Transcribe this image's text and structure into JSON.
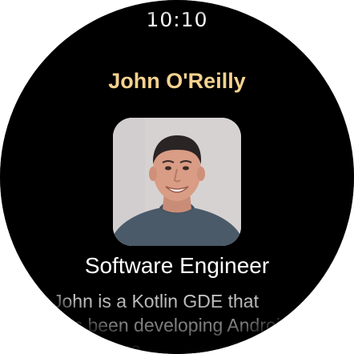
{
  "status": {
    "time": "10:10"
  },
  "profile": {
    "name": "John O'Reilly",
    "title": "Software Engineer",
    "bio": "John is a Kotlin GDE that has been developing Android apps since"
  },
  "colors": {
    "name": "#f5d28f",
    "background": "#000000",
    "text": "#ffffff",
    "bio": "#c9c9c9"
  }
}
